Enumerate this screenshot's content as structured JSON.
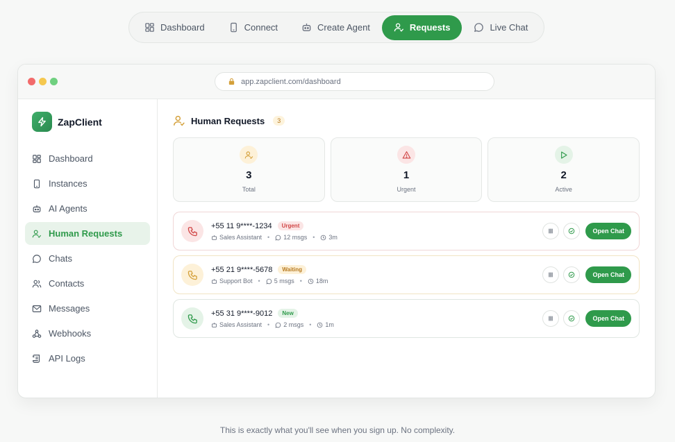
{
  "topnav": {
    "items": [
      {
        "label": "Dashboard",
        "icon": "dashboard-icon"
      },
      {
        "label": "Connect",
        "icon": "phone-device-icon"
      },
      {
        "label": "Create Agent",
        "icon": "bot-icon"
      },
      {
        "label": "Requests",
        "icon": "user-check-icon",
        "active": true
      },
      {
        "label": "Live Chat",
        "icon": "chat-bubble-icon"
      }
    ]
  },
  "browser": {
    "url": "app.zapclient.com/dashboard"
  },
  "sidebar": {
    "brand": "ZapClient",
    "items": [
      {
        "label": "Dashboard"
      },
      {
        "label": "Instances"
      },
      {
        "label": "AI Agents"
      },
      {
        "label": "Human Requests",
        "active": true
      },
      {
        "label": "Chats"
      },
      {
        "label": "Contacts"
      },
      {
        "label": "Messages"
      },
      {
        "label": "Webhooks"
      },
      {
        "label": "API Logs"
      }
    ]
  },
  "main": {
    "title": "Human Requests",
    "count": "3",
    "stats": [
      {
        "value": "3",
        "label": "Total"
      },
      {
        "value": "1",
        "label": "Urgent"
      },
      {
        "value": "2",
        "label": "Active"
      }
    ],
    "requests": [
      {
        "phone": "+55 11 9****-1234",
        "status": "Urgent",
        "agent": "Sales Assistant",
        "msgs": "12 msgs",
        "time": "3m",
        "action": "Open Chat"
      },
      {
        "phone": "+55 21 9****-5678",
        "status": "Waiting",
        "agent": "Support Bot",
        "msgs": "5 msgs",
        "time": "18m",
        "action": "Open Chat"
      },
      {
        "phone": "+55 31 9****-9012",
        "status": "New",
        "agent": "Sales Assistant",
        "msgs": "2 msgs",
        "time": "1m",
        "action": "Open Chat"
      }
    ]
  },
  "footer": {
    "text": "This is exactly what you'll see when you sign up. No complexity."
  },
  "colors": {
    "accent": "#2f9a4b",
    "urgent": "#d04545",
    "waiting": "#b7791f"
  }
}
